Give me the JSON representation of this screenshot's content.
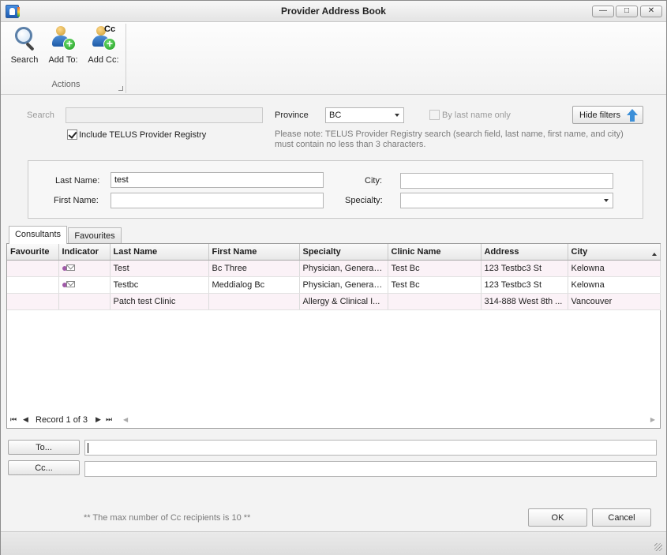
{
  "window": {
    "title": "Provider Address Book",
    "icon": "address-book-icon",
    "controls": {
      "minimize": "—",
      "maximize": "□",
      "close": "✕"
    }
  },
  "ribbon": {
    "buttons": [
      {
        "label": "Search",
        "icon": "search-icon"
      },
      {
        "label": "Add To:",
        "icon": "add-person-icon"
      },
      {
        "label": "Add Cc:",
        "icon": "add-cc-person-icon",
        "badge": "Cc"
      }
    ],
    "group_label": "Actions"
  },
  "filters": {
    "search_label": "Search",
    "search_value": "",
    "province_label": "Province",
    "province_value": "BC",
    "by_last_name_label": "By last name only",
    "by_last_name_checked": false,
    "hide_filters_label": "Hide filters",
    "include_registry_label": "Include TELUS Provider Registry",
    "include_registry_checked": true,
    "note": "Please note: TELUS Provider Registry search (search field, last name, first name, and city) must contain no less than 3 characters.",
    "last_name_label": "Last Name:",
    "last_name_value": "test",
    "first_name_label": "First Name:",
    "first_name_value": "",
    "city_label": "City:",
    "city_value": "",
    "specialty_label": "Specialty:",
    "specialty_value": ""
  },
  "tabs": [
    {
      "label": "Consultants",
      "active": true
    },
    {
      "label": "Favourites",
      "active": false
    }
  ],
  "grid": {
    "columns": [
      "Favourite",
      "Indicator",
      "Last Name",
      "First Name",
      "Specialty",
      "Clinic Name",
      "Address",
      "City"
    ],
    "rows": [
      {
        "favourite": "",
        "indicator": "envelope-icon",
        "last_name": "Test",
        "first_name": "Bc Three",
        "specialty": "Physician, General ...",
        "clinic": "Test Bc",
        "address": "123  Testbc3 St",
        "city": "Kelowna"
      },
      {
        "favourite": "",
        "indicator": "envelope-icon",
        "last_name": "Testbc",
        "first_name": "Meddialog Bc",
        "specialty": "Physician, General ...",
        "clinic": "Test Bc",
        "address": "123  Testbc3 St",
        "city": "Kelowna"
      },
      {
        "favourite": "",
        "indicator": "",
        "last_name": "Patch test Clinic",
        "first_name": "",
        "specialty": "Allergy & Clinical I...",
        "clinic": "",
        "address": "314-888 West 8th ...",
        "city": "Vancouver"
      }
    ],
    "record_text": "Record 1 of 3",
    "nav": {
      "first": "⏮",
      "prev": "◀",
      "next": "▶",
      "last": "⏭"
    }
  },
  "recipients": {
    "to_label": "To...",
    "to_value": "",
    "cc_label": "Cc...",
    "cc_value": ""
  },
  "footer": {
    "note": "** The max number of Cc recipients is 10 **",
    "ok_label": "OK",
    "cancel_label": "Cancel"
  }
}
